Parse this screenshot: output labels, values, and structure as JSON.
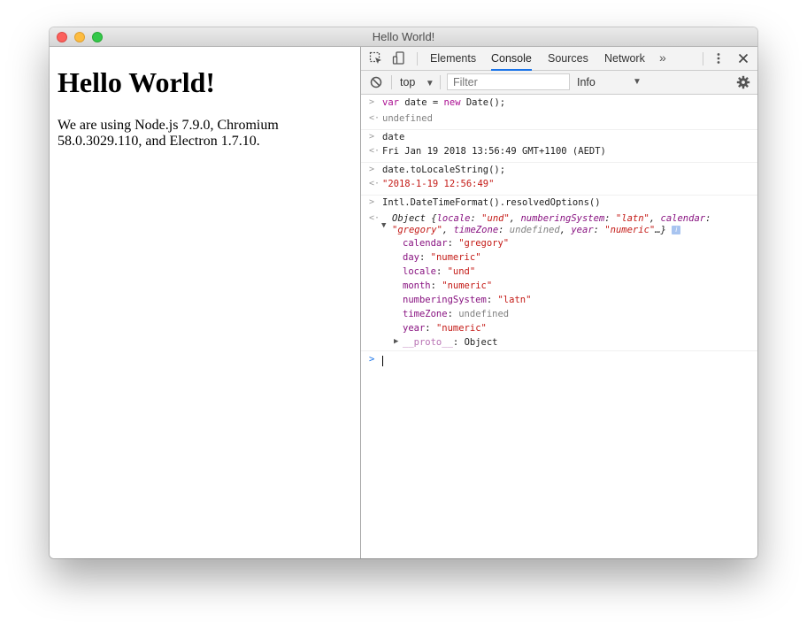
{
  "window": {
    "title": "Hello World!"
  },
  "page": {
    "heading": "Hello World!",
    "paragraph": "We are using Node.js 7.9.0, Chromium 58.0.3029.110, and Electron 1.7.10."
  },
  "devtools": {
    "tabs": [
      "Elements",
      "Console",
      "Sources",
      "Network"
    ],
    "active_tab": "Console",
    "more_tabs_glyph": "»",
    "toolbar": {
      "context": "top",
      "filter_placeholder": "Filter",
      "level": "Info"
    },
    "console": {
      "cmd1": {
        "kw": "var",
        "a": " date = ",
        "kw2": "new",
        "b": " Date();"
      },
      "res1": "undefined",
      "cmd2": "date",
      "res2": "Fri Jan 19 2018 13:56:49 GMT+1100 (AEDT)",
      "cmd3": "date.toLocaleString();",
      "res3": "\"2018-1-19 12:56:49\"",
      "cmd4": "Intl.DateTimeFormat().resolvedOptions()",
      "obj_summary": {
        "open": "Object {",
        "k1": "locale",
        "v1": "\"und\"",
        "k2": "numberingSystem",
        "v2": "\"latn\"",
        "k3": "calendar",
        "v3": "\"gregory\"",
        "k4": "timeZone",
        "v4": "undefined",
        "k5": "year",
        "v5": "\"numeric\"",
        "close": "…}",
        "badge": "i"
      },
      "props": [
        {
          "key": "calendar",
          "value": "\"gregory\""
        },
        {
          "key": "day",
          "value": "\"numeric\""
        },
        {
          "key": "locale",
          "value": "\"und\""
        },
        {
          "key": "month",
          "value": "\"numeric\""
        },
        {
          "key": "numberingSystem",
          "value": "\"latn\""
        },
        {
          "key": "timeZone",
          "value": "undefined"
        },
        {
          "key": "year",
          "value": "\"numeric\""
        }
      ],
      "proto_key": "__proto__",
      "proto_value": "Object"
    }
  }
}
